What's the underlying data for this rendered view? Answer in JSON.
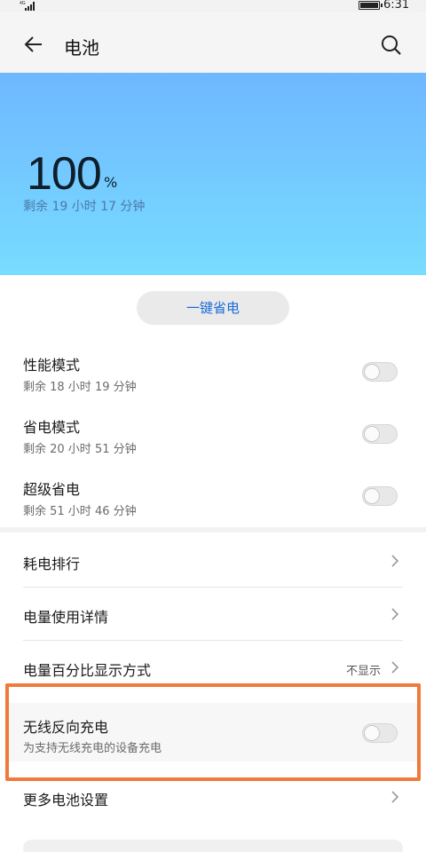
{
  "status_bar": {
    "network": "4G",
    "time": "6:31"
  },
  "header": {
    "title": "电池"
  },
  "battery": {
    "percent": "100",
    "percent_sign": "%",
    "remaining": "剩余 19 小时 17 分钟",
    "level_fraction": 1.0
  },
  "one_key_button": "一键省电",
  "modes": [
    {
      "label": "性能模式",
      "sub": "剩余 18 小时 19 分钟",
      "enabled": false
    },
    {
      "label": "省电模式",
      "sub": "剩余 20 小时 51 分钟",
      "enabled": false
    },
    {
      "label": "超级省电",
      "sub": "剩余 51 小时 46 分钟",
      "enabled": false
    }
  ],
  "menu": {
    "usage_rank": "耗电排行",
    "usage_details": "电量使用详情",
    "percent_display": {
      "label": "电量百分比显示方式",
      "value": "不显示"
    },
    "wireless_reverse": {
      "label": "无线反向充电",
      "sub": "为支持无线充电的设备充电",
      "enabled": false
    },
    "more_settings": "更多电池设置"
  },
  "colors": {
    "hero_top": "#6fb7ff",
    "hero_bottom": "#78dcff",
    "accent": "#1a6bd8",
    "highlight": "#f07a3c"
  }
}
